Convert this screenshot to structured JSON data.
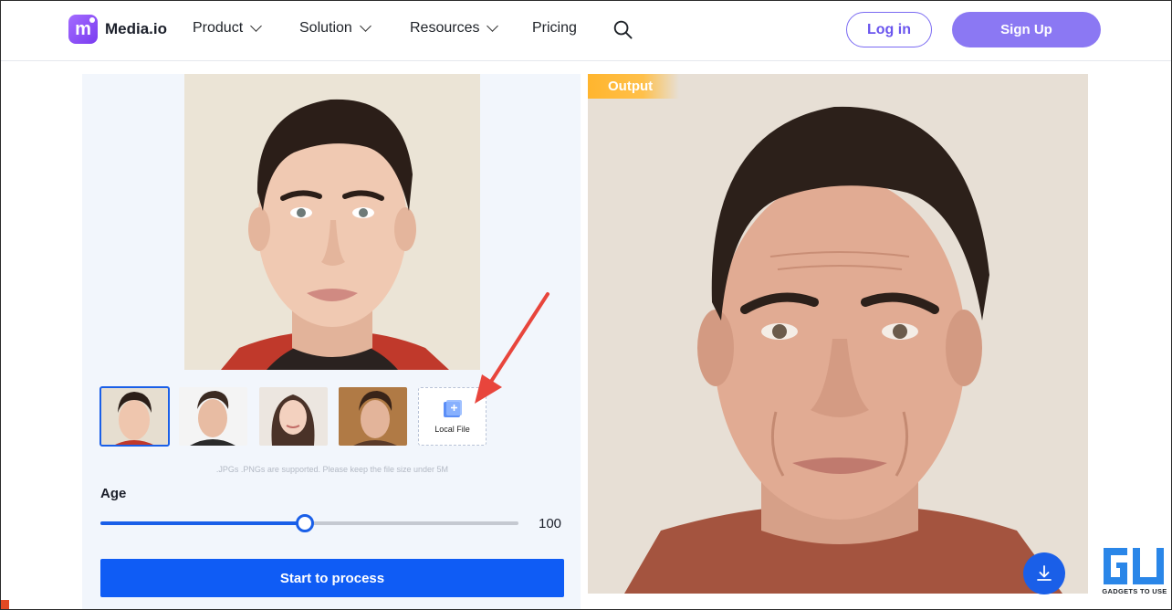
{
  "nav": {
    "brand": "Media.io",
    "items": [
      {
        "label": "Product",
        "has_dropdown": true
      },
      {
        "label": "Solution",
        "has_dropdown": true
      },
      {
        "label": "Resources",
        "has_dropdown": true
      },
      {
        "label": "Pricing",
        "has_dropdown": false
      }
    ],
    "login_label": "Log in",
    "signup_label": "Sign Up"
  },
  "editor": {
    "thumbnails": [
      "sample-face-1",
      "sample-face-2",
      "sample-face-3",
      "sample-face-4"
    ],
    "local_file_label": "Local File",
    "hint": ".JPGs .PNGs are supported. Please keep the file size under 5M",
    "age_label": "Age",
    "age_value": "100",
    "age_fraction": 0.49,
    "start_label": "Start to process"
  },
  "output": {
    "tag": "Output"
  },
  "watermark": {
    "text": "GADGETS TO USE"
  },
  "colors": {
    "primary": "#1a5fe8",
    "brand_purple": "#8b78f3",
    "output_tag": "#ffb52e",
    "annotation_arrow": "#e8453c"
  }
}
